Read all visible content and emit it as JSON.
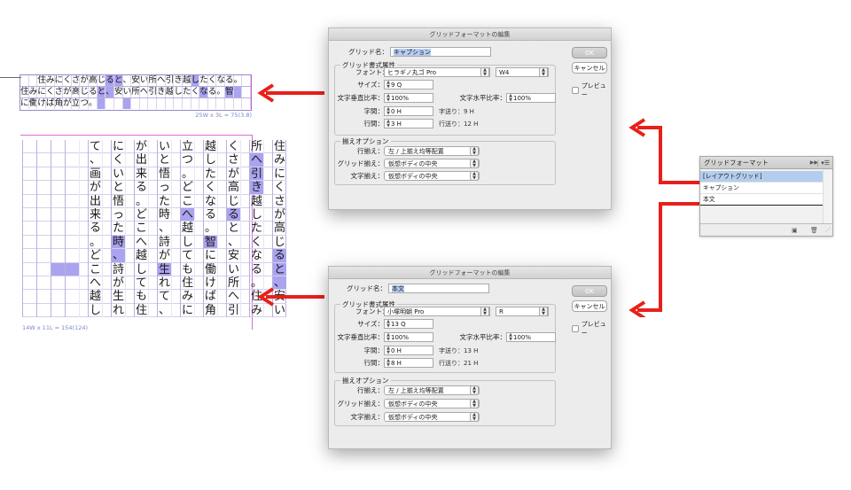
{
  "horizontal_sample": {
    "rows": [
      {
        "cells": [
          "",
          "",
          "住",
          "み",
          "に",
          "く",
          "さ",
          "が",
          "高",
          "じ",
          "る",
          "と",
          "、",
          "安",
          "い",
          "所",
          "へ",
          "引",
          "き",
          "越",
          "し",
          "た",
          "く",
          "な",
          "る",
          "。",
          ""
        ],
        "highlight": [
          10,
          11,
          20
        ]
      },
      {
        "cells": [
          "住",
          "み",
          "に",
          "く",
          "さ",
          "が",
          "高",
          "じ",
          "る",
          "と",
          "、",
          "安",
          "い",
          "所",
          "へ",
          "引",
          "き",
          "越",
          "し",
          "た",
          "く",
          "な",
          "る",
          "。",
          "智",
          "",
          ""
        ],
        "highlight": [
          9,
          10,
          21,
          24,
          25
        ]
      },
      {
        "cells": [
          "に",
          "働",
          "け",
          "ば",
          "角",
          "が",
          "立",
          "つ",
          "。",
          "",
          "",
          "",
          "",
          "",
          "",
          "",
          "",
          "",
          "",
          "",
          "",
          "",
          "",
          "",
          "",
          "",
          ""
        ],
        "highlight": [
          9,
          12
        ]
      }
    ],
    "caption": "25W x 3L = 75(3.8)"
  },
  "vertical_sample": {
    "columns": [
      {
        "chars": "住みにくさが高じると、安い",
        "hl": [
          8,
          9,
          10
        ]
      },
      {
        "chars": "",
        "gap": true
      },
      {
        "chars": "所へ引き越したくなる。住みに",
        "hl": [
          1,
          2,
          3
        ]
      },
      {
        "chars": "",
        "gap": true
      },
      {
        "chars": "くさが高じると、安い所へ引き",
        "hl": [
          5
        ]
      },
      {
        "chars": "",
        "gap": true
      },
      {
        "chars": "越したくなる。智に働けば角が",
        "hl": [
          7
        ]
      },
      {
        "chars": "",
        "gap": true
      },
      {
        "chars": "立つ。どこへ越しても住みにく",
        "hl": [
          5
        ]
      },
      {
        "chars": "",
        "gap": true
      },
      {
        "chars": "いと悟った時、詩が生れて、画",
        "hl": [
          9
        ]
      },
      {
        "chars": "",
        "gap": true
      },
      {
        "chars": "が出来る。どこへ越しても住み",
        "hl": []
      },
      {
        "chars": "",
        "gap": true
      },
      {
        "chars": "にくいと悟った時、詩が生れ",
        "hl": [
          7,
          8
        ]
      },
      {
        "chars": "",
        "gap": true
      },
      {
        "chars": "て、画が出来る。どこへ越して",
        "hl": []
      },
      {
        "chars": "",
        "gap": true
      },
      {
        "chars": "",
        "hl": [
          9
        ]
      },
      {
        "chars": "",
        "hl": [
          9
        ]
      },
      {
        "chars": "",
        "hl": []
      },
      {
        "chars": "",
        "hl": []
      }
    ],
    "caption": "14W x 11L = 154(124)"
  },
  "dialog_top": {
    "title": "グリッドフォーマットの編集",
    "name_label": "グリッド名：",
    "name_value": "キャプション",
    "attr_group": "グリッド書式属性",
    "font_label": "フォント：",
    "font_family": "ヒラギノ丸ゴ Pro",
    "font_style": "W4",
    "size_label": "サイズ：",
    "size_value": "9 Q",
    "vscale_label": "文字垂直比率：",
    "vscale_value": "100%",
    "hscale_label": "文字水平比率：",
    "hscale_value": "100%",
    "tracking_label": "字間：",
    "tracking_value": "0 H",
    "char_advance": "字送り：9 H",
    "leading_label": "行間：",
    "leading_value": "3 H",
    "line_advance": "行送り：12 H",
    "align_group": "揃えオプション",
    "line_align_label": "行揃え：",
    "line_align_value": "左 / 上揃え均等配置",
    "grid_align_label": "グリッド揃え：",
    "grid_align_value": "仮想ボディの中央",
    "char_align_label": "文字揃え：",
    "char_align_value": "仮想ボディの中央",
    "ok": "OK",
    "cancel": "キャンセル",
    "preview": "プレビュー"
  },
  "dialog_bottom": {
    "title": "グリッドフォーマットの編集",
    "name_label": "グリッド名：",
    "name_value": "本文",
    "attr_group": "グリッド書式属性",
    "font_label": "フォント：",
    "font_family": "小塚明朝 Pro",
    "font_style": "R",
    "size_label": "サイズ：",
    "size_value": "13 Q",
    "vscale_label": "文字垂直比率：",
    "vscale_value": "100%",
    "hscale_label": "文字水平比率：",
    "hscale_value": "100%",
    "tracking_label": "字間：",
    "tracking_value": "0 H",
    "char_advance": "字送り：13 H",
    "leading_label": "行間：",
    "leading_value": "8 H",
    "line_advance": "行送り：21 H",
    "align_group": "揃えオプション",
    "line_align_label": "行揃え：",
    "line_align_value": "左 / 上揃え均等配置",
    "grid_align_label": "グリッド揃え：",
    "grid_align_value": "仮想ボディの中央",
    "char_align_label": "文字揃え：",
    "char_align_value": "仮想ボディの中央",
    "ok": "OK",
    "cancel": "キャンセル",
    "preview": "プレビュー"
  },
  "panel": {
    "title": "グリッドフォーマット",
    "items": [
      "[レイアウトグリッド]",
      "キャプション",
      "本文"
    ],
    "selected_index": 0
  },
  "colors": {
    "arrow": "#e8201a",
    "grid_highlight": "#aaa3ef",
    "grid_line": "#b8b0de",
    "frame": "#d86ad7",
    "selection": "#b4cdee"
  }
}
